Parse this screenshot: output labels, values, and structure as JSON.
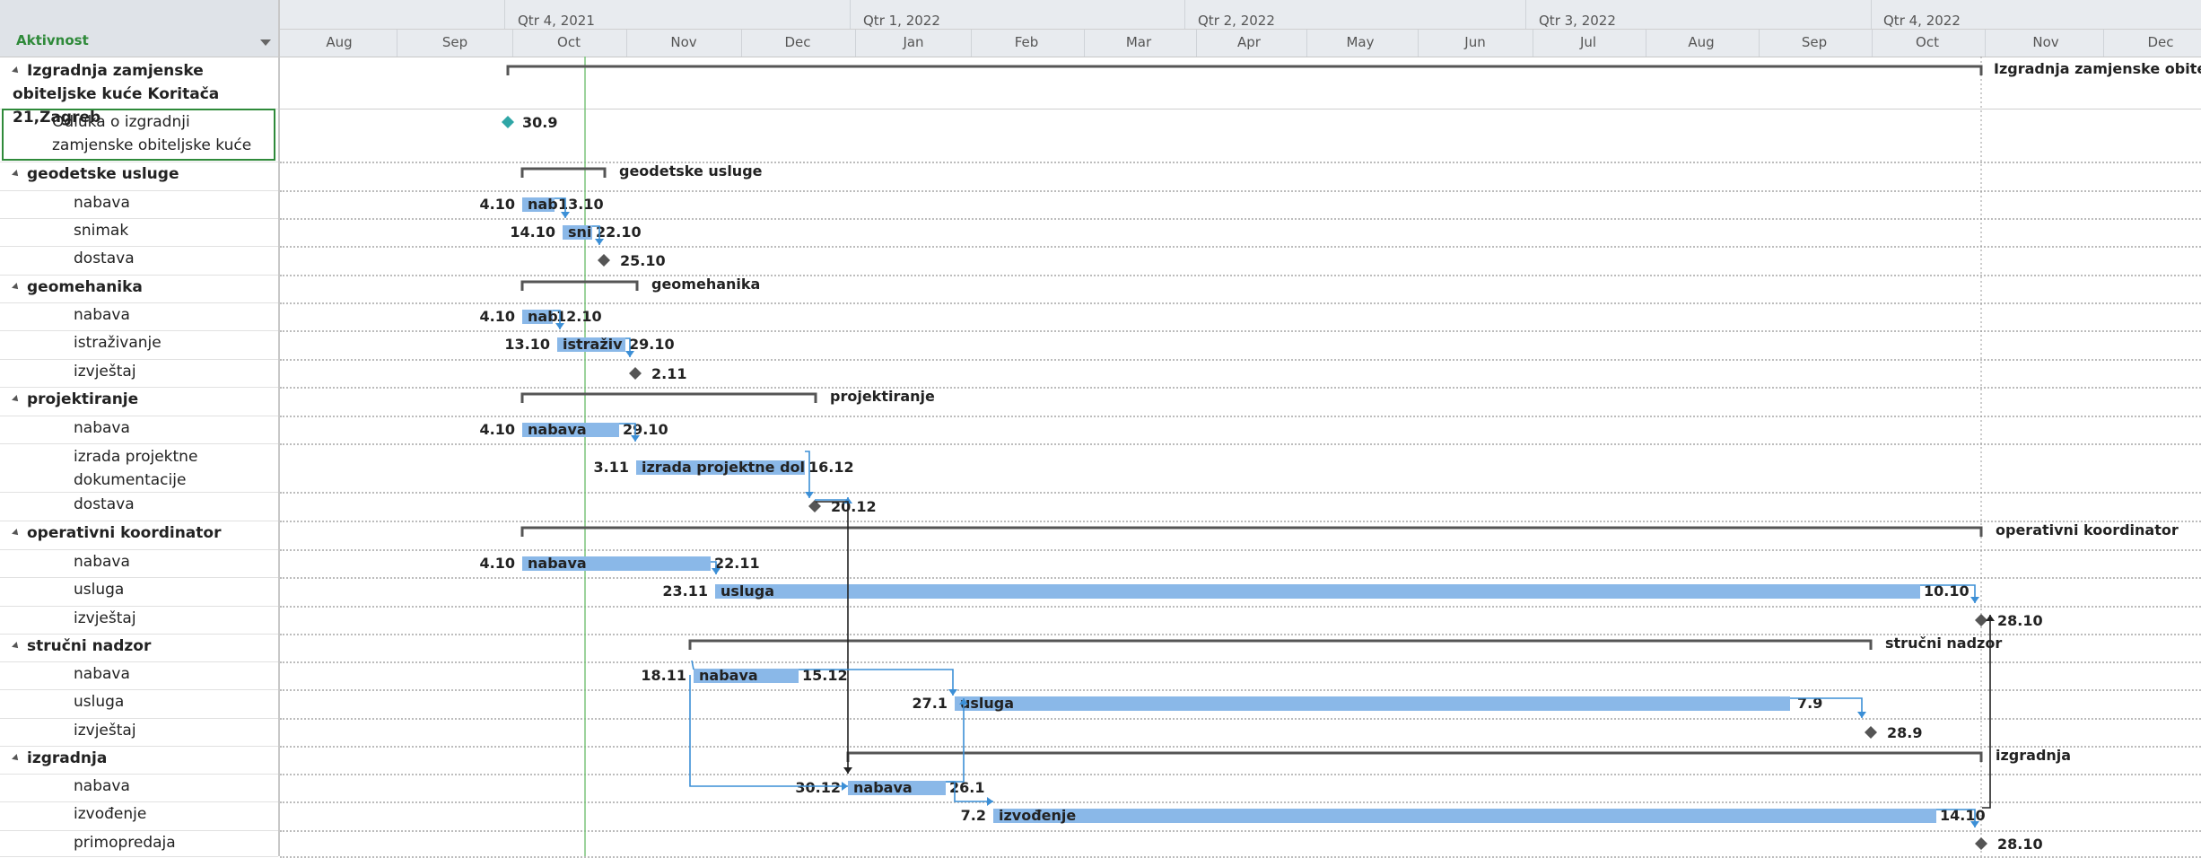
{
  "header": {
    "activity_label": "Aktivnost"
  },
  "timescale": {
    "quarters": [
      "Qtr 4, 2021",
      "Qtr 1, 2022",
      "Qtr 2, 2022",
      "Qtr 3, 2022",
      "Qtr 4, 2022"
    ],
    "months": [
      "Aug",
      "Sep",
      "Oct",
      "Nov",
      "Dec",
      "Jan",
      "Feb",
      "Mar",
      "Apr",
      "May",
      "Jun",
      "Jul",
      "Aug",
      "Sep",
      "Oct",
      "Nov",
      "Dec"
    ]
  },
  "tasks": [
    {
      "name": "Izgradnja zamjenske obiteljske kuće Koritača 21,Zagreb",
      "summary": true
    },
    {
      "name": "Odluka o izgradnji zamjenske obiteljske kuće",
      "summary": false
    },
    {
      "name": "geodetske usluge",
      "summary": true
    },
    {
      "name": "nabava",
      "summary": false
    },
    {
      "name": "snimak",
      "summary": false
    },
    {
      "name": "dostava",
      "summary": false
    },
    {
      "name": "geomehanika",
      "summary": true
    },
    {
      "name": "nabava",
      "summary": false
    },
    {
      "name": "istraživanje",
      "summary": false
    },
    {
      "name": "izvještaj",
      "summary": false
    },
    {
      "name": "projektiranje",
      "summary": true
    },
    {
      "name": "nabava",
      "summary": false
    },
    {
      "name": "izrada projektne dokumentacije",
      "summary": false
    },
    {
      "name": "dostava",
      "summary": false
    },
    {
      "name": "operativni koordinator",
      "summary": true
    },
    {
      "name": "nabava",
      "summary": false
    },
    {
      "name": "usluga",
      "summary": false
    },
    {
      "name": "izvještaj",
      "summary": false
    },
    {
      "name": "stručni nadzor",
      "summary": true
    },
    {
      "name": "nabava",
      "summary": false
    },
    {
      "name": "usluga",
      "summary": false
    },
    {
      "name": "izvještaj",
      "summary": false
    },
    {
      "name": "izgradnja",
      "summary": true
    },
    {
      "name": "nabava",
      "summary": false
    },
    {
      "name": "izvođenje",
      "summary": false
    },
    {
      "name": "primopredaja",
      "summary": false
    }
  ],
  "bars": [
    {
      "row": 0,
      "type": "summary",
      "start": "1.10.2021",
      "end": "31.12.2022",
      "right_label": "Izgradnja zamjenske obitelj"
    },
    {
      "row": 1,
      "type": "milestone",
      "date": "30.9",
      "right_label": "30.9"
    },
    {
      "row": 2,
      "type": "summary",
      "right_label": "geodetske usluge"
    },
    {
      "row": 3,
      "type": "task",
      "left_label": "4.10",
      "bar_text": "nab",
      "right_label": "13.10"
    },
    {
      "row": 4,
      "type": "task",
      "left_label": "14.10",
      "bar_text": "sni",
      "right_label": "22.10"
    },
    {
      "row": 5,
      "type": "milestone",
      "right_label": "25.10"
    },
    {
      "row": 6,
      "type": "summary",
      "right_label": "geomehanika"
    },
    {
      "row": 7,
      "type": "task",
      "left_label": "4.10",
      "bar_text": "nab",
      "right_label": "12.10"
    },
    {
      "row": 8,
      "type": "task",
      "left_label": "13.10",
      "bar_text": "istraživ",
      "right_label": "29.10"
    },
    {
      "row": 9,
      "type": "milestone",
      "right_label": "2.11"
    },
    {
      "row": 10,
      "type": "summary",
      "right_label": "projektiranje"
    },
    {
      "row": 11,
      "type": "task",
      "left_label": "4.10",
      "bar_text": "nabava",
      "right_label": "29.10"
    },
    {
      "row": 12,
      "type": "task",
      "left_label": "3.11",
      "bar_text": "izrada projektne dol",
      "right_label": "16.12"
    },
    {
      "row": 13,
      "type": "milestone",
      "right_label": "20.12"
    },
    {
      "row": 14,
      "type": "summary",
      "right_label": "operativni koordinator"
    },
    {
      "row": 15,
      "type": "task",
      "left_label": "4.10",
      "bar_text": "nabava",
      "right_label": "22.11"
    },
    {
      "row": 16,
      "type": "task",
      "left_label": "23.11",
      "bar_text": "usluga",
      "right_label": "10.10"
    },
    {
      "row": 17,
      "type": "milestone",
      "right_label": "28.10"
    },
    {
      "row": 18,
      "type": "summary",
      "right_label": "stručni nadzor"
    },
    {
      "row": 19,
      "type": "task",
      "left_label": "18.11",
      "bar_text": "nabava",
      "right_label": "15.12"
    },
    {
      "row": 20,
      "type": "task",
      "left_label": "27.1",
      "bar_text": "usluga",
      "right_label": "7.9"
    },
    {
      "row": 21,
      "type": "milestone",
      "right_label": "28.9"
    },
    {
      "row": 22,
      "type": "summary",
      "right_label": "izgradnja"
    },
    {
      "row": 23,
      "type": "task",
      "left_label": "30.12",
      "bar_text": "nabava",
      "right_label": "26.1"
    },
    {
      "row": 24,
      "type": "task",
      "left_label": "7.2",
      "bar_text": "izvođenje",
      "right_label": "14.10"
    },
    {
      "row": 25,
      "type": "milestone",
      "right_label": "28.10"
    }
  ],
  "colors": {
    "bar": "#8ab8e8",
    "summary": "#555555",
    "milestone_teal": "#2fa6a6",
    "milestone": "#555555",
    "link": "#3c8fd6",
    "today": "#7cc47c"
  }
}
